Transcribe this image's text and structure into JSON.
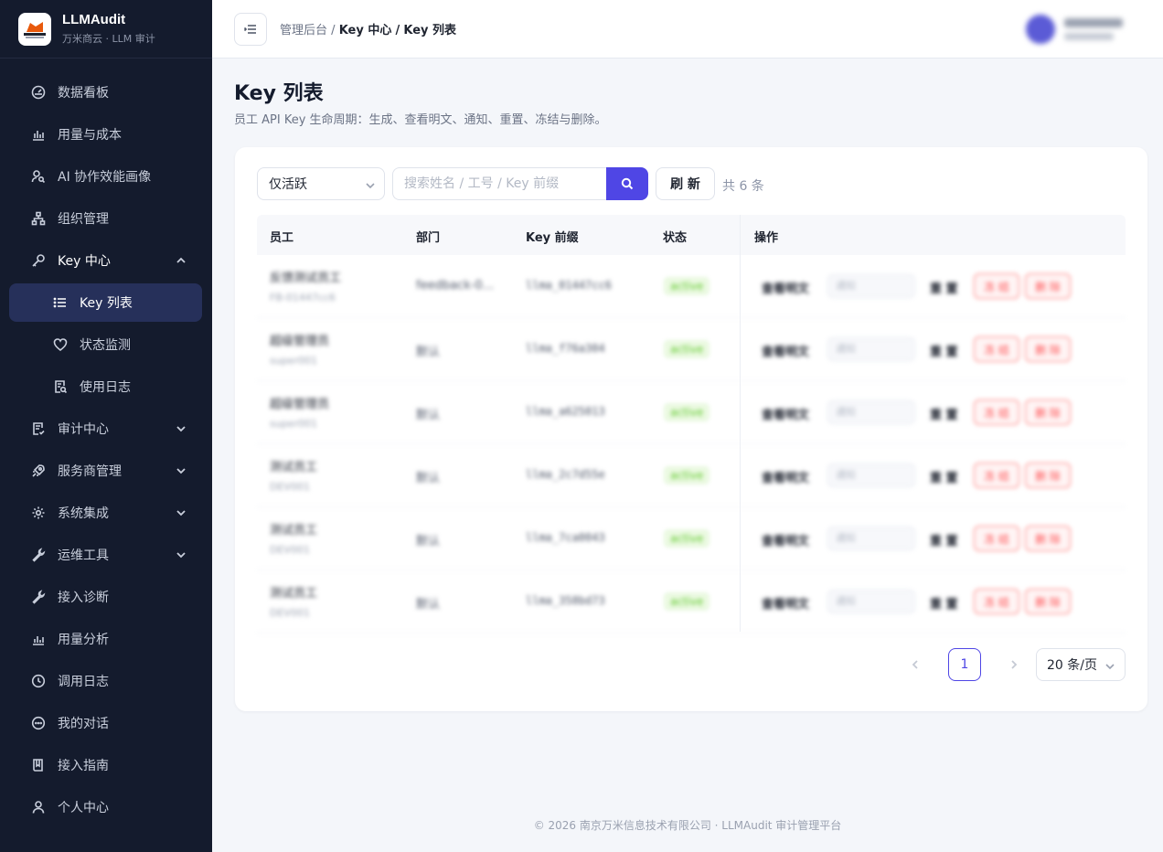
{
  "brand": {
    "title": "LLMAudit",
    "subtitle": "万米商云 · LLM 审计",
    "logo_text": "万米商云"
  },
  "sidebar": {
    "items": [
      {
        "label": "数据看板",
        "icon": "dashboard-icon"
      },
      {
        "label": "用量与成本",
        "icon": "bar-chart-icon"
      },
      {
        "label": "AI 协作效能画像",
        "icon": "user-search-icon"
      },
      {
        "label": "组织管理",
        "icon": "org-icon"
      },
      {
        "label": "Key 中心",
        "icon": "key-icon",
        "open": true,
        "children": [
          {
            "label": "Key 列表",
            "icon": "list-icon",
            "active": true
          },
          {
            "label": "状态监测",
            "icon": "heart-icon"
          },
          {
            "label": "使用日志",
            "icon": "log-search-icon"
          }
        ]
      },
      {
        "label": "审计中心",
        "icon": "audit-icon"
      },
      {
        "label": "服务商管理",
        "icon": "rocket-icon"
      },
      {
        "label": "系统集成",
        "icon": "gear-icon"
      },
      {
        "label": "运维工具",
        "icon": "wrench-icon"
      },
      {
        "label": "接入诊断",
        "icon": "diagnose-icon"
      },
      {
        "label": "用量分析",
        "icon": "analytics-icon"
      },
      {
        "label": "调用日志",
        "icon": "history-icon"
      },
      {
        "label": "我的对话",
        "icon": "chat-icon"
      },
      {
        "label": "接入指南",
        "icon": "book-icon"
      },
      {
        "label": "个人中心",
        "icon": "person-icon"
      }
    ]
  },
  "header": {
    "breadcrumb": {
      "root": "管理后台",
      "sep": "/",
      "mid": "Key 中心",
      "cur": "Key 列表"
    }
  },
  "page": {
    "title": "Key 列表",
    "description": "员工 API Key 生命周期：生成、查看明文、通知、重置、冻结与删除。"
  },
  "filters": {
    "status_select": "仅活跃",
    "search_placeholder": "搜索姓名 / 工号 / Key 前缀",
    "refresh_label": "刷 新",
    "total_text": "共 6 条"
  },
  "table": {
    "columns": [
      "员工",
      "部门",
      "Key 前缀",
      "状态",
      "操作"
    ],
    "rows": [
      {
        "name": "反馈测试员工",
        "code": "FB-01447cc6",
        "dept": "feedback-0...",
        "key": "llma_01447cc6",
        "status": "active",
        "view": "查看明文",
        "select": "通知",
        "reset": "重 置",
        "freeze": "冻 结",
        "delete": "删 除"
      },
      {
        "name": "超级管理员",
        "code": "super001",
        "dept": "默认",
        "key": "llma_f76a304",
        "status": "active",
        "view": "查看明文",
        "select": "通知",
        "reset": "重 置",
        "freeze": "冻 结",
        "delete": "删 除"
      },
      {
        "name": "超级管理员",
        "code": "super001",
        "dept": "默认",
        "key": "llma_a625013",
        "status": "active",
        "view": "查看明文",
        "select": "通知",
        "reset": "重 置",
        "freeze": "冻 结",
        "delete": "删 除"
      },
      {
        "name": "测试员工",
        "code": "DEV001",
        "dept": "默认",
        "key": "llma_2c7d55e",
        "status": "active",
        "view": "查看明文",
        "select": "通知",
        "reset": "重 置",
        "freeze": "冻 结",
        "delete": "删 除"
      },
      {
        "name": "测试员工",
        "code": "DEV001",
        "dept": "默认",
        "key": "llma_7ca0043",
        "status": "active",
        "view": "查看明文",
        "select": "通知",
        "reset": "重 置",
        "freeze": "冻 结",
        "delete": "删 除"
      },
      {
        "name": "测试员工",
        "code": "DEV001",
        "dept": "默认",
        "key": "llma_358bd73",
        "status": "active",
        "view": "查看明文",
        "select": "通知",
        "reset": "重 置",
        "freeze": "冻 结",
        "delete": "删 除"
      }
    ]
  },
  "pagination": {
    "current": "1",
    "page_size": "20 条/页"
  },
  "footer": {
    "text": "© 2026 南京万米信息技术有限公司  ·  LLMAudit 审计管理平台"
  },
  "colors": {
    "accent": "#4f46e5",
    "sidebar_bg": "#141b2d",
    "active_green": "#52c41a",
    "danger": "#ff4d4f"
  }
}
